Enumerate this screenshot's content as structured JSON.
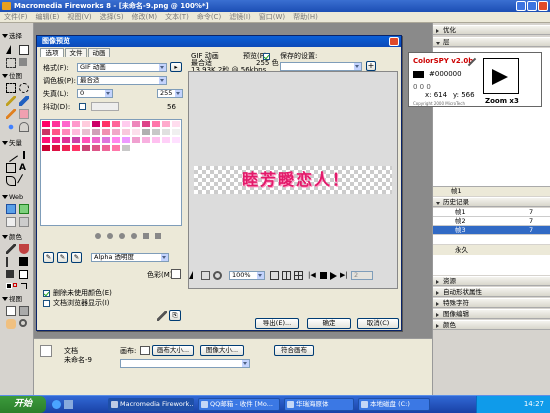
{
  "app": {
    "title": "Macromedia Fireworks 8 - [未命名-9.png @ 100%*]",
    "menu": [
      "文件(F)",
      "编辑(E)",
      "视图(V)",
      "选择(S)",
      "修改(M)",
      "文本(T)",
      "命令(C)",
      "滤镜(I)",
      "窗口(W)",
      "帮助(H)"
    ]
  },
  "tools": {
    "sections": [
      "选择",
      "位图",
      "矢量",
      "Web",
      "颜色",
      "视图"
    ]
  },
  "dialog": {
    "title": "图像预览",
    "tabs": [
      "选项",
      "文件",
      "动画"
    ],
    "format_label": "格式(F):",
    "format_value": "GIF 动画",
    "palette_label": "调色板(P):",
    "palette_value": "最合适",
    "loss_label": "失真(L):",
    "loss_value": "0",
    "colors_value": "255",
    "dither_label": "抖动(D):",
    "dither_value": "56",
    "transparency_value": "Alpha 透明度",
    "matte_label": "色彩(M):",
    "remove_unused_label": "删除未使用颜色(E)",
    "show_in_browser_label": "文档浏览器显示(I)",
    "preview_format": "GIF 动画",
    "preview_palette": "最合适",
    "preview_size": "13.93K  2秒 @ 56kbps",
    "preview_check_label": "预览(P)",
    "preview_colors": "255 色",
    "saved_settings_label": "保存的设置:",
    "preview_text": "睦芳瞹恋人！",
    "zoom_value": "100%",
    "frame_value": "2",
    "export_button": "导出(E)...",
    "ok_button": "确定",
    "cancel_button": "取消(C)"
  },
  "right_panel": {
    "optimize_label": "优化",
    "layers_label": "层",
    "frames_label": "帧1",
    "history_label": "历史记录",
    "frames": [
      {
        "name": "帧1",
        "delay": "7"
      },
      {
        "name": "帧2",
        "delay": "7"
      },
      {
        "name": "帧3",
        "delay": "7"
      }
    ],
    "permanent_label": "永久",
    "sections": [
      "资源",
      "自动形状属性",
      "特殊字符",
      "图像编辑",
      "颜色"
    ]
  },
  "colorspy": {
    "title": "ColorSPY v2.0b",
    "hex": "#000000",
    "rgb": "0 0 0",
    "x": "x: 614",
    "y": "y: 566",
    "zoom": "Zoom x3",
    "copyright": "Copyright 2000 MicroTech"
  },
  "properties": {
    "doc_label": "文档",
    "doc_name": "未命名-9",
    "canvas_label": "画布:",
    "canvas_size_button": "画布大小...",
    "image_size_button": "图像大小...",
    "fit_canvas_button": "符合画布"
  },
  "taskbar": {
    "start": "开始",
    "tasks": [
      "Macromedia Firework...",
      "QQ邮箱 - 收件 [Mo...",
      "华瑞海原体",
      "本地磁盘 (C:)"
    ],
    "time": "14:27"
  },
  "palette_colors": [
    "#ff0066",
    "#ff3399",
    "#ff66cc",
    "#ff99cc",
    "#ffccdd",
    "#cc0066",
    "#ff3366",
    "#ff6699",
    "#ffccee",
    "#ee88bb",
    "#dd4488",
    "#ff77aa",
    "#ffaacc",
    "#ffddee",
    "#cc3366",
    "#ff5588",
    "#ff88bb",
    "#ffbbdd",
    "#e8c0d0",
    "#d0a0b8",
    "#f090b0",
    "#f0a8c8",
    "#f8c8dc",
    "#fce0ec",
    "#b0b0b0",
    "#c8c8c8",
    "#e0e0e0",
    "#f0f0f0",
    "#ff1177",
    "#ee2288",
    "#dd3399",
    "#cc44aa",
    "#ff55bb",
    "#ee66cc",
    "#dd77dd",
    "#ff88ee",
    "#ee99ff",
    "#f0a0d0",
    "#f8b0e0",
    "#ffc0f0",
    "#ffd0f8",
    "#ffe0ff",
    "#cc0033",
    "#dd1144",
    "#ee2255",
    "#ff3366",
    "#cc4477",
    "#dd5588",
    "#ee6699",
    "#ff77aa",
    "#c8c8c8",
    "#ffffff"
  ],
  "colors": {
    "accent": "#e21a6a",
    "title_blue": "#0a5fd8",
    "taskbar_blue": "#245edb"
  }
}
